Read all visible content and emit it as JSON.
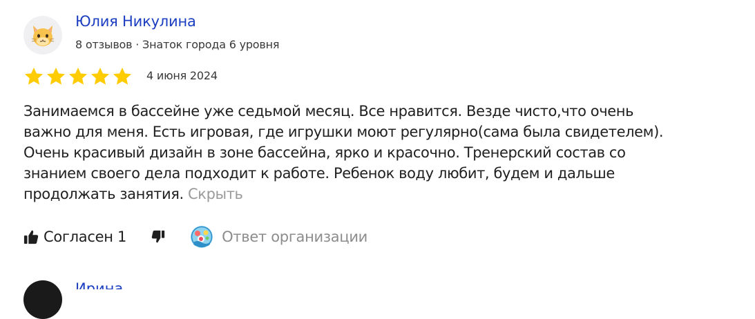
{
  "review": {
    "author": {
      "name": "Юлия Никулина",
      "meta": "8 отзывов · Знаток города 6 уровня",
      "avatar_icon": "cat-face-emoji-icon"
    },
    "rating": {
      "value": 5,
      "max": 5,
      "star_color": "#fc0"
    },
    "date": "4 июня 2024",
    "text_lines": [
      "Занимаемся в бассейне уже седьмой месяц. Все нравится. Везде чисто,что очень",
      "важно для меня. Есть игровая, где игрушки моют регулярно(сама была свидетелем).",
      "Очень красивый дизайн в зоне бассейна, ярко и красочно. Тренерский состав со",
      "знанием своего дела подходит к работе. Ребенок воду любит, будем и дальше",
      "продолжать занятия."
    ],
    "collapse_label": "Скрыть",
    "actions": {
      "like_label": "Согласен 1",
      "like_icon": "thumbs-up-icon",
      "dislike_icon": "thumbs-down-icon",
      "org_reply_label": "Ответ организации",
      "org_logo_icon": "organization-logo-icon"
    }
  },
  "next_review": {
    "author_name": "Ирина Бол"
  },
  "colors": {
    "link_blue": "#1a3dc1",
    "text_dark": "#1f1f1f",
    "text_meta": "#383838",
    "text_muted": "#9a9a9a",
    "star_gold": "#fc0"
  }
}
